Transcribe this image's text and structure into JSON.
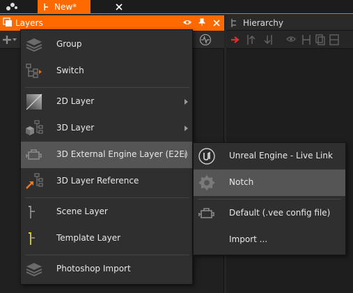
{
  "document_tab": {
    "label": "New*"
  },
  "layers_panel": {
    "title": "Layers"
  },
  "hierarchy_panel": {
    "title": "Hierarchy"
  },
  "menu": {
    "items": [
      {
        "label": "Group",
        "icon": "group-layers-icon"
      },
      {
        "label": "Switch",
        "icon": "switch-icon"
      },
      {
        "label": "2D Layer",
        "icon": "2d-layer-icon",
        "has_submenu": true
      },
      {
        "label": "3D Layer",
        "icon": "3d-layer-icon",
        "has_submenu": true
      },
      {
        "label": "3D External Engine Layer (E2E)",
        "icon": "engine-icon",
        "has_submenu": true,
        "highlighted": true
      },
      {
        "label": "3D Layer Reference",
        "icon": "layer-reference-icon"
      },
      {
        "label": "Scene Layer",
        "icon": "scene-layer-icon"
      },
      {
        "label": "Template Layer",
        "icon": "template-layer-icon"
      },
      {
        "label": "Photoshop Import",
        "icon": "photoshop-import-icon"
      }
    ]
  },
  "submenu": {
    "items": [
      {
        "label": "Unreal Engine - Live Link",
        "icon": "unreal-engine-icon"
      },
      {
        "label": "Notch",
        "icon": "notch-icon",
        "highlighted": true
      },
      {
        "label": "Default (.vee config file)",
        "icon": "engine-icon"
      },
      {
        "label": "Import ...",
        "icon": ""
      }
    ]
  },
  "colors": {
    "accent": "#ff6a00",
    "menu_bg": "#2f2f2f",
    "highlight": "#555555"
  }
}
